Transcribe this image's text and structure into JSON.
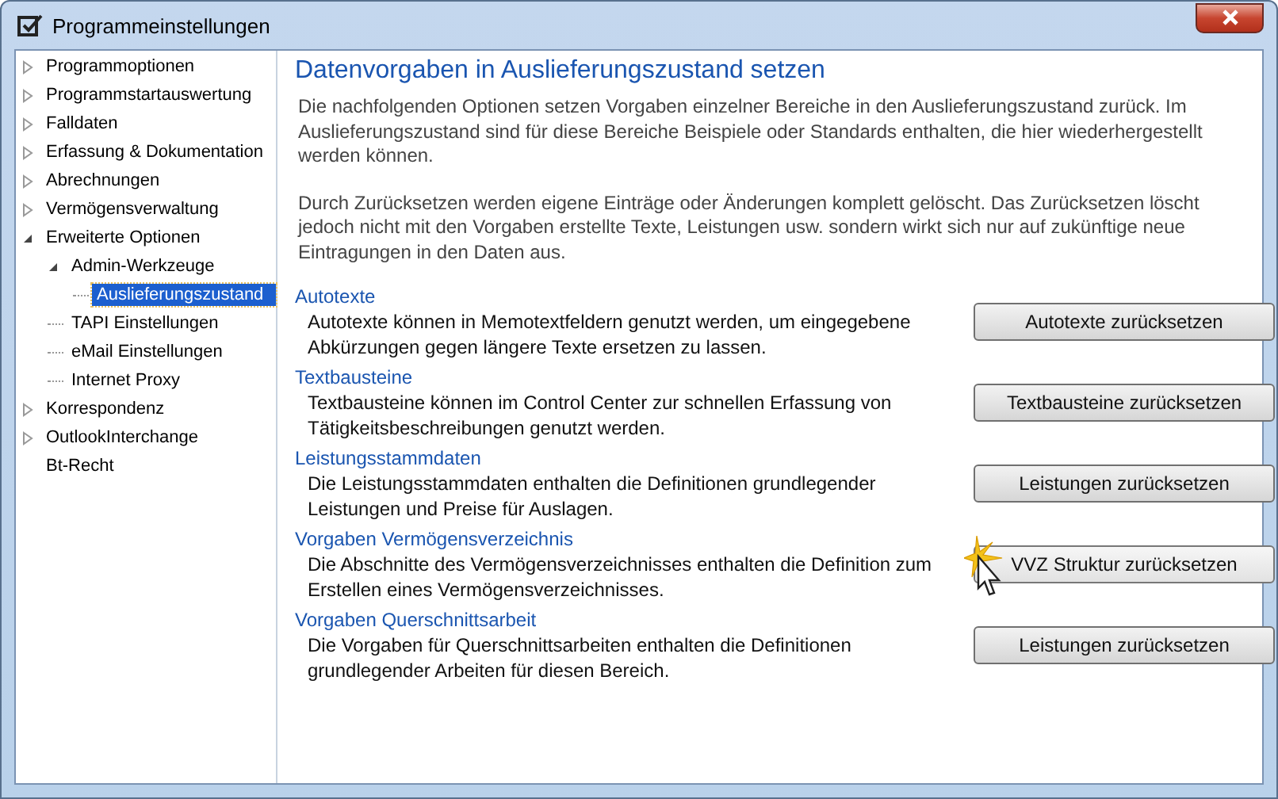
{
  "window": {
    "title": "Programmeinstellungen"
  },
  "sidebar": {
    "items": [
      {
        "label": "Programmoptionen",
        "expanded": false,
        "selected": false
      },
      {
        "label": "Programmstartauswertung",
        "expanded": false,
        "selected": false
      },
      {
        "label": "Falldaten",
        "expanded": false,
        "selected": false
      },
      {
        "label": "Erfassung & Dokumentation",
        "expanded": false,
        "selected": false
      },
      {
        "label": "Abrechnungen",
        "expanded": false,
        "selected": false
      },
      {
        "label": "Vermögensverwaltung",
        "expanded": false,
        "selected": false
      },
      {
        "label": "Erweiterte Optionen",
        "expanded": true,
        "selected": false,
        "children": [
          {
            "label": "Admin-Werkzeuge",
            "expanded": true,
            "selected": false,
            "children": [
              {
                "label": "Auslieferungszustand",
                "selected": true
              }
            ]
          },
          {
            "label": "TAPI Einstellungen",
            "selected": false
          },
          {
            "label": "eMail Einstellungen",
            "selected": false
          },
          {
            "label": "Internet Proxy",
            "selected": false
          }
        ]
      },
      {
        "label": "Korrespondenz",
        "expanded": false,
        "selected": false
      },
      {
        "label": "OutlookInterchange",
        "expanded": false,
        "selected": false
      },
      {
        "label": "Bt-Recht",
        "selected": false
      }
    ]
  },
  "content": {
    "heading": "Datenvorgaben in Auslieferungszustand setzen",
    "paragraphs": [
      "Die nachfolgenden Optionen setzen Vorgaben einzelner Bereiche in den Auslieferungszustand zurück. Im Auslieferungszustand sind für diese Bereiche Beispiele oder Standards enthalten, die hier wiederhergestellt werden können.",
      "Durch Zurücksetzen werden eigene Einträge oder Änderungen komplett gelöscht. Das Zurücksetzen löscht jedoch nicht mit den Vorgaben erstellte Texte, Leistungen usw. sondern wirkt sich nur auf zukünftige neue Eintragungen in den Daten aus."
    ],
    "sections": [
      {
        "title": "Autotexte",
        "description": "Autotexte können in Memotextfeldern genutzt werden, um eingegebene Abkürzungen gegen längere Texte ersetzen zu lassen.",
        "button": "Autotexte zurücksetzen",
        "hovered": false
      },
      {
        "title": "Textbausteine",
        "description": "Textbausteine können im Control Center zur schnellen Erfassung von Tätigkeitsbeschreibungen genutzt werden.",
        "button": "Textbausteine zurücksetzen",
        "hovered": false
      },
      {
        "title": "Leistungsstammdaten",
        "description": "Die Leistungsstammdaten enthalten die Definitionen grundlegender Leistungen und Preise für Auslagen.",
        "button": "Leistungen zurücksetzen",
        "hovered": false
      },
      {
        "title": "Vorgaben Vermögensverzeichnis",
        "description": "Die Abschnitte des Vermögensverzeichnisses enthalten die Definition zum Erstellen eines Vermögensverzeichnisses.",
        "button": "VVZ Struktur zurücksetzen",
        "hovered": true
      },
      {
        "title": "Vorgaben Querschnittsarbeit",
        "description": "Die Vorgaben für Querschnittsarbeiten enthalten die Definitionen grundlegender Arbeiten für diesen Bereich.",
        "button": "Leistungen zurücksetzen",
        "hovered": false
      }
    ]
  }
}
